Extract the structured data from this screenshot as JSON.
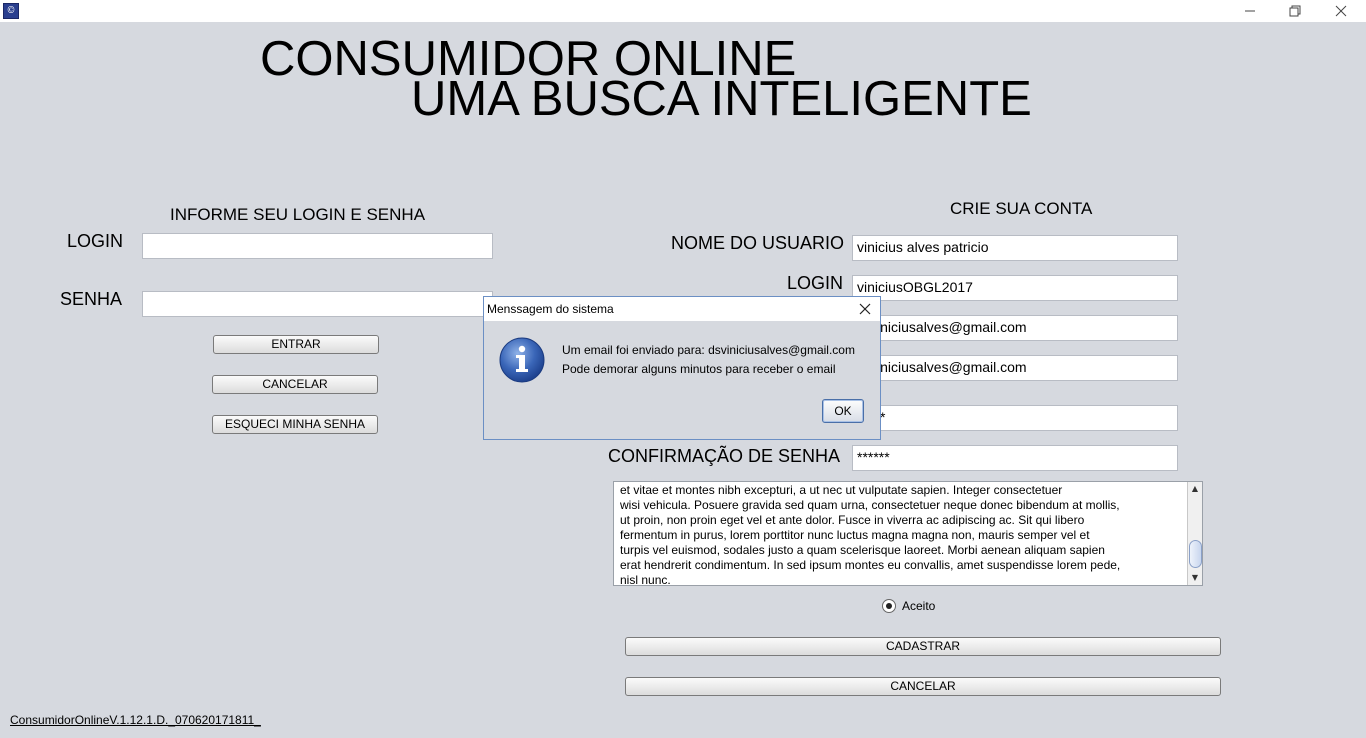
{
  "window": {
    "minimize_glyph": "—",
    "restore_glyph": "❐",
    "close_glyph": "✕"
  },
  "header": {
    "line1": "CONSUMIDOR ONLINE",
    "line2": "UMA BUSCA INTELIGENTE"
  },
  "login_panel": {
    "title": "INFORME SEU LOGIN E SENHA",
    "login_label": "LOGIN",
    "login_value": "",
    "password_label": "SENHA",
    "password_value": "",
    "enter_button": "ENTRAR",
    "cancel_button": "CANCELAR",
    "forgot_button": "ESQUECI MINHA SENHA"
  },
  "register_panel": {
    "title": "CRIE SUA CONTA",
    "username_label": "NOME DO USUARIO",
    "username_value": "vinicius alves patricio",
    "login_label": "LOGIN",
    "login_value": "viniciusOBGL2017",
    "email_value": "iniciusalves@gmail.com",
    "email_confirm_value": "iniciusalves@gmail.com",
    "password_value": "*",
    "password_confirm_label": "CONFIRMAÇÃO DE SENHA",
    "password_confirm_value": "******",
    "terms_text": "et vitae et montes nibh excepturi, a ut nec ut vulputate sapien. Integer consectetuer\nwisi vehicula. Posuere gravida sed quam urna, consectetuer neque donec bibendum at mollis,\nut proin, non proin eget vel et ante dolor. Fusce in viverra ac adipiscing ac. Sit qui libero\nfermentum in purus, lorem porttitor nunc luctus magna magna non, mauris semper vel et\nturpis vel euismod, sodales justo a quam scelerisque laoreet. Morbi aenean aliquam sapien\nerat hendrerit condimentum. In sed ipsum montes eu convallis, amet suspendisse lorem pede,\nnisl nunc.",
    "accept_label": "Aceito",
    "accept_selected": true,
    "register_button": "CADASTRAR",
    "cancel_button": "CANCELAR"
  },
  "dialog": {
    "title": "Menssagem do sistema",
    "line1": "Um email foi enviado para: dsviniciusalves@gmail.com",
    "line2": "Pode demorar alguns minutos para receber o email",
    "ok_button": "OK",
    "icon": "info-icon"
  },
  "footer": {
    "version": "ConsumidorOnlineV.1.12.1.D._070620171811_"
  },
  "colors": {
    "background": "#d6d9df",
    "dialog_border": "#6b8fc4",
    "info_icon": "#2b57a8"
  }
}
